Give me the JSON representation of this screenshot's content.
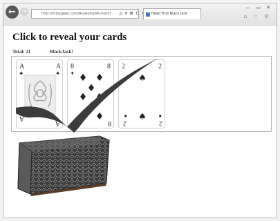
{
  "browser": {
    "back_glyph": "←",
    "forward_glyph": "→",
    "address": "http://thinkgeek.com/AcademyVR-mxhtl...",
    "address_controls": "ρ ▾ ⊠ C ✕",
    "tab_title": "Head First Black Jack",
    "window_controls": "— ▭ ✕",
    "tool_icons": "⌂ ☆ ⚙"
  },
  "page": {
    "heading": "Click to reveal your cards",
    "total_label": "Total: 21",
    "result_label": "BlackJack!"
  },
  "cards": [
    {
      "rank": "A",
      "suit": "♣",
      "pips": 1,
      "color": "#222222"
    },
    {
      "rank": "8",
      "suit": "♦",
      "pips": 8,
      "color": "#222222"
    },
    {
      "rank": "2",
      "suit": "♠",
      "pips": 2,
      "color": "#222222"
    }
  ],
  "colors": {
    "checkmark": "#3c3c3c",
    "deck_edge": "#5a3e2a"
  }
}
